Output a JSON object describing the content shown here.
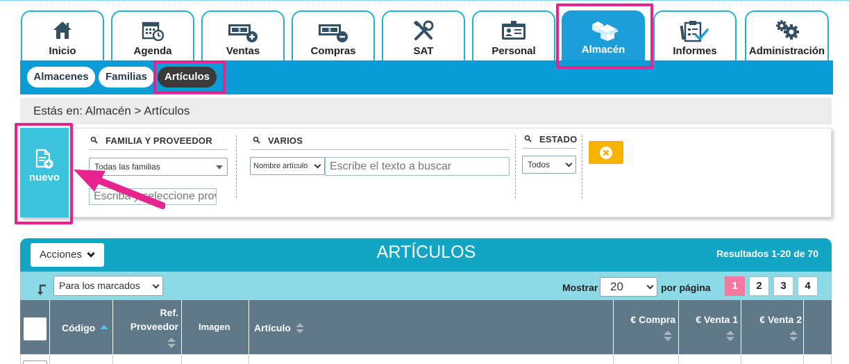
{
  "nav": {
    "tabs": [
      {
        "label": "Inicio",
        "icon": "home-icon"
      },
      {
        "label": "Agenda",
        "icon": "calendar-icon"
      },
      {
        "label": "Ventas",
        "icon": "money-plus-icon"
      },
      {
        "label": "Compras",
        "icon": "money-minus-icon"
      },
      {
        "label": "SAT",
        "icon": "tools-icon"
      },
      {
        "label": "Personal",
        "icon": "id-card-icon"
      },
      {
        "label": "Almacén",
        "icon": "boxes-icon"
      },
      {
        "label": "Informes",
        "icon": "clipboard-check-icon"
      },
      {
        "label": "Administración",
        "icon": "gears-icon"
      }
    ],
    "active": "Almacén"
  },
  "subnav": {
    "items": [
      {
        "label": "Almacenes"
      },
      {
        "label": "Familias"
      },
      {
        "label": "Artículos"
      }
    ],
    "active": "Artículos"
  },
  "breadcrumb": "Estás en: Almacén > Artículos",
  "new_button": {
    "label": "nuevo",
    "icon": "new-document-icon"
  },
  "filters": {
    "familia": {
      "title": "FAMILIA Y PROVEEDOR",
      "family_select": "Todas las familias",
      "provider_placeholder": "Escriba y seleccione proveedor"
    },
    "varios": {
      "title": "VARIOS",
      "field_select": "Nombre artículo",
      "search_placeholder": "Escribe el texto a buscar"
    },
    "estado": {
      "title": "ESTADO",
      "select": "Todos"
    },
    "clear_icon": "close-circle-icon"
  },
  "results": {
    "acciones_label": "Acciones",
    "title": "ARTÍCULOS",
    "count": "Resultados 1-20 de 70",
    "bulk_select": "Para los marcados",
    "mostrar_label": "Mostrar",
    "per_page": "20",
    "per_page_label": "por página",
    "pages": [
      "1",
      "2",
      "3",
      "4"
    ],
    "current_page": "1",
    "columns": [
      {
        "label": "Código"
      },
      {
        "label": "Ref. Proveedor"
      },
      {
        "label": "Imagen"
      },
      {
        "label": "Artículo"
      },
      {
        "label": "€ Compra"
      },
      {
        "label": "€ Venta 1"
      },
      {
        "label": "€ Venta 2"
      }
    ]
  },
  "colors": {
    "accent": "#1e9ed8",
    "highlight": "#e6238f",
    "new_button": "#3bc4dc",
    "clear_button": "#f5b300",
    "table_header": "#5f7989",
    "current_page": "#f27aa0"
  }
}
